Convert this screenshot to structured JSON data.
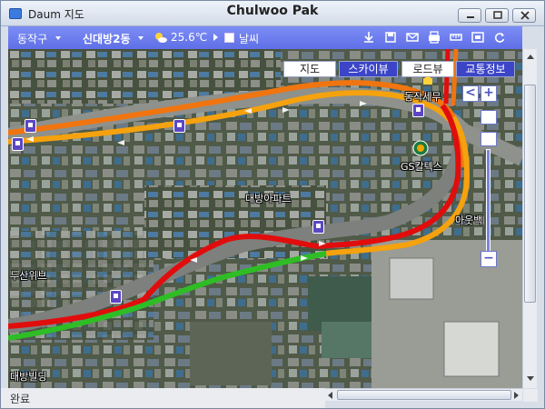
{
  "window": {
    "title": "Daum 지도",
    "user": "Chulwoo Pak"
  },
  "toolbar": {
    "district": "동작구",
    "neighborhood": "신대방2동",
    "temperature": "25.6℃",
    "weather_toggle_label": "날씨",
    "weather_icon": "partly-cloudy-icon",
    "tool_icons": [
      "download-icon",
      "save-icon",
      "mail-icon",
      "print-icon",
      "measure-icon",
      "fullscreen-icon",
      "refresh-icon"
    ]
  },
  "map_tabs": [
    {
      "label": "지도",
      "active": false
    },
    {
      "label": "스카이뷰",
      "active": true
    },
    {
      "label": "로드뷰",
      "active": false
    },
    {
      "label": "교통정보",
      "active": true
    }
  ],
  "places": [
    "동작세무",
    "GS칼텍스",
    "대방아파트",
    "아웃백",
    "두산위브",
    "대방빌딩"
  ],
  "zoom": {
    "in_label": "+",
    "out_label": "−",
    "back_label": "<"
  },
  "traffic_colors": {
    "jam": "#e10d0d",
    "slow": "#f5a20e",
    "moderate": "#f07510",
    "free": "#2ebd25"
  },
  "status": {
    "text": "완료"
  }
}
